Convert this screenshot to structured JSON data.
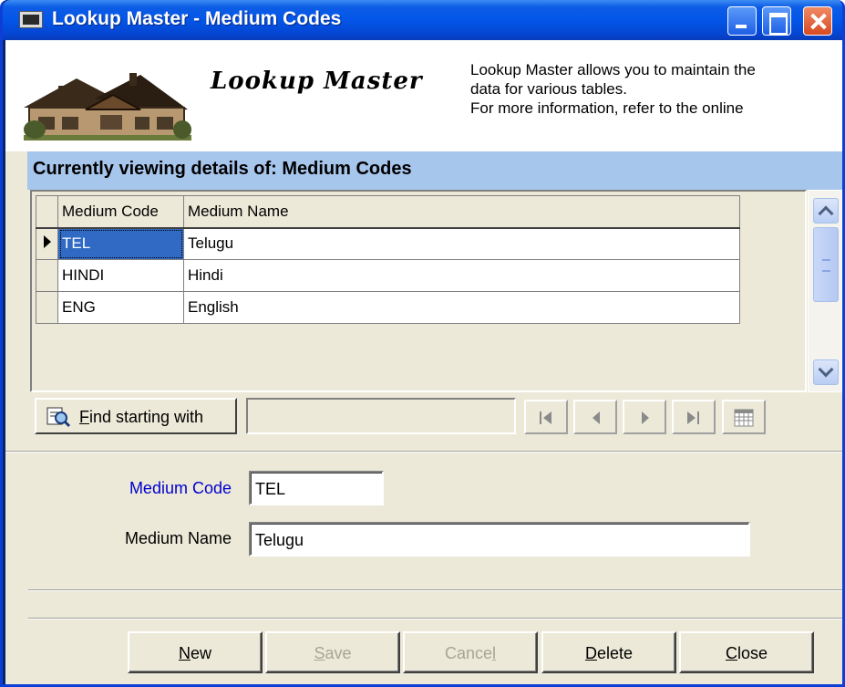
{
  "window": {
    "title": "Lookup Master - Medium Codes"
  },
  "header": {
    "title": "Lookup Master",
    "info_lines": [
      "Lookup Master allows you to maintain the",
      "data for various tables.",
      "For more information, refer to the online"
    ]
  },
  "caption": "Currently viewing details of: Medium Codes",
  "grid": {
    "columns": [
      "Medium Code",
      "Medium Name"
    ],
    "rows": [
      {
        "code": "TEL",
        "name": "Telugu"
      },
      {
        "code": "HINDI",
        "name": "Hindi"
      },
      {
        "code": "ENG",
        "name": "English"
      }
    ],
    "selected_row": 0
  },
  "navbar": {
    "find_label_first": "F",
    "find_label_rest": "ind starting with",
    "find_value": ""
  },
  "form": {
    "code_label": "Medium Code",
    "code_value": "TEL",
    "name_label": "Medium Name",
    "name_value": "Telugu"
  },
  "buttons": {
    "new": {
      "first": "N",
      "rest": "ew"
    },
    "save": {
      "first": "S",
      "rest": "ave"
    },
    "cancel": {
      "rest": "Cance",
      "last": "l"
    },
    "delete": {
      "first": "D",
      "rest": "elete"
    },
    "close": {
      "first": "C",
      "rest": "lose"
    }
  },
  "colors": {
    "caption_bg": "#a7c6ec",
    "code_label": "#0000d0",
    "selected_cell": "#316ac5"
  }
}
